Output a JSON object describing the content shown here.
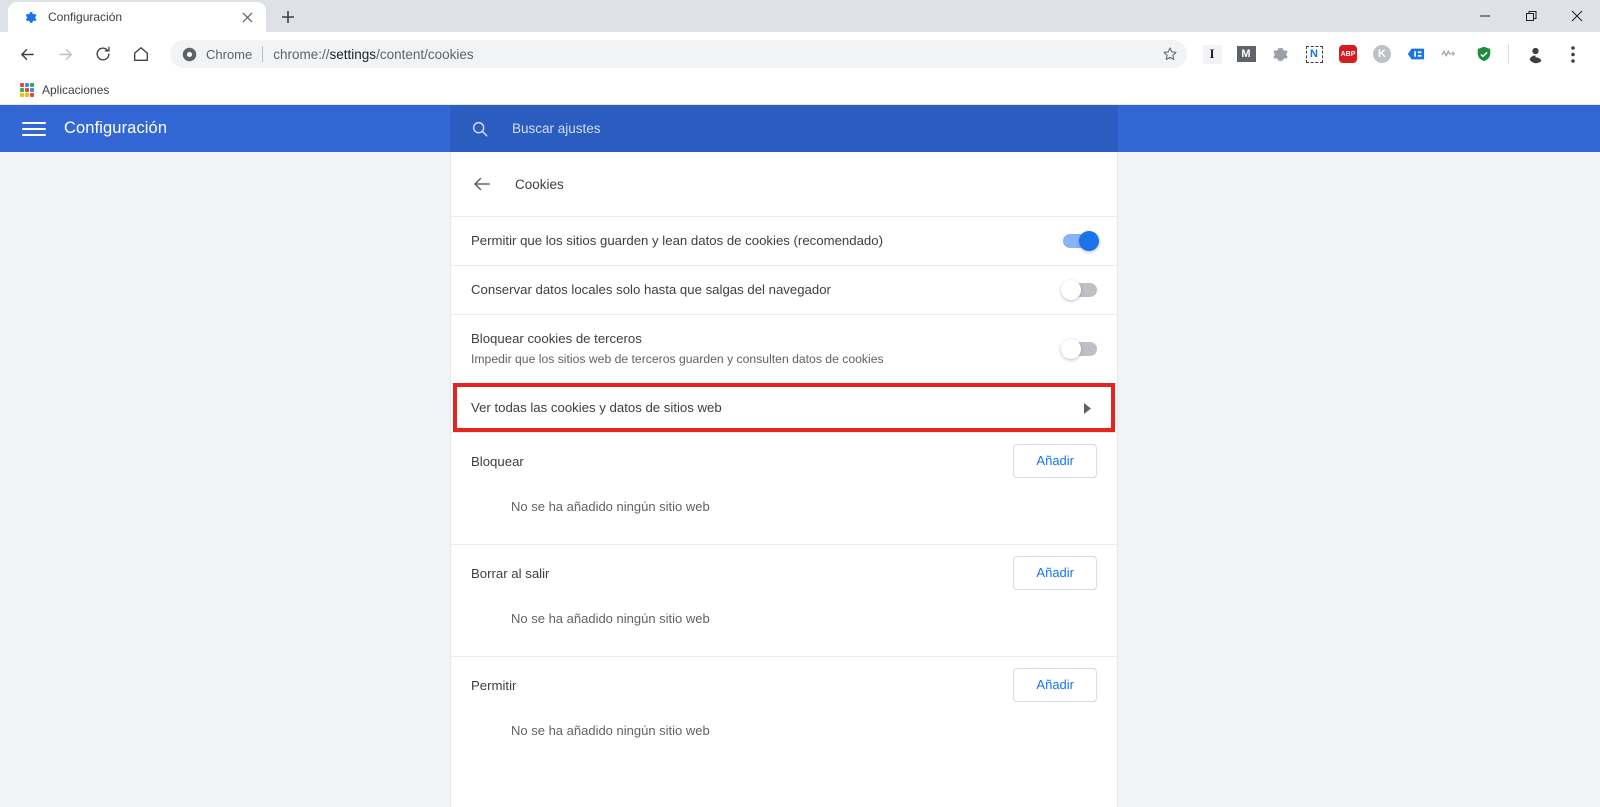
{
  "window": {
    "controls": {
      "minimize": "minimize-icon",
      "maximize": "maximize-icon",
      "close": "close-icon"
    }
  },
  "browser": {
    "tab": {
      "title": "Configuración",
      "favicon": "settings-gear-icon",
      "close_label": "×"
    },
    "new_tab_label": "+",
    "nav": {
      "back": "back-arrow-icon",
      "forward": "forward-arrow-icon",
      "reload": "reload-icon",
      "home": "home-icon"
    },
    "omnibox": {
      "chip": "Chrome",
      "url_prefix": "chrome://",
      "url_bold": "settings",
      "url_suffix": "/content/cookies",
      "full_url": "chrome://settings/content/cookies",
      "star": "bookmark-star-icon"
    },
    "extensions": [
      {
        "name": "instapaper-extension",
        "glyph": "I",
        "bg": "#f1f3f4",
        "fg": "#202124"
      },
      {
        "name": "mailtrack-extension",
        "glyph": "M",
        "bg": "#5f6368",
        "fg": "#ffffff"
      },
      {
        "name": "gear-extension",
        "glyph": "⚙",
        "bg": "transparent",
        "fg": "#9aa0a6"
      },
      {
        "name": "nimbus-extension",
        "glyph": "N",
        "bg": "transparent",
        "fg": "#1a73e8"
      },
      {
        "name": "adblock-plus-extension",
        "glyph": "ABP",
        "bg": "#d81b1b",
        "fg": "#ffffff"
      },
      {
        "name": "kaspersky-extension",
        "glyph": "K",
        "bg": "#bdc1c6",
        "fg": "#ffffff"
      },
      {
        "name": "blue-tag-extension",
        "glyph": "▤",
        "bg": "transparent",
        "fg": "#1a73e8"
      },
      {
        "name": "wave-extension",
        "glyph": "ᴡ",
        "bg": "transparent",
        "fg": "#9aa0a6"
      },
      {
        "name": "green-shield-extension",
        "glyph": "♻",
        "bg": "transparent",
        "fg": "#1e8e3e"
      }
    ],
    "profile": "profile-avatar-icon",
    "menu": "three-dot-menu-icon",
    "bookmarks": [
      {
        "name": "apps-shortcut",
        "label": "Aplicaciones",
        "icon": "apps-grid-icon"
      }
    ]
  },
  "settings": {
    "header": {
      "menu_button": "hamburger-menu-icon",
      "title": "Configuración",
      "search_icon": "search-icon",
      "search_placeholder": "Buscar ajustes",
      "search_value": ""
    },
    "page": {
      "back": "back-arrow-icon",
      "title": "Cookies"
    },
    "toggle_rows": [
      {
        "name": "allow-sites-save-read-cookies",
        "title": "Permitir que los sitios guarden y lean datos de cookies (recomendado)",
        "sub": "",
        "state": "on"
      },
      {
        "name": "keep-local-data-until-quit",
        "title": "Conservar datos locales solo hasta que salgas del navegador",
        "sub": "",
        "state": "off"
      },
      {
        "name": "block-third-party-cookies",
        "title": "Bloquear cookies de terceros",
        "sub": "Impedir que los sitios web de terceros guarden y consulten datos de cookies",
        "state": "off"
      }
    ],
    "highlighted_row": {
      "name": "see-all-cookies-and-site-data",
      "title": "Ver todas las cookies y datos de sitios web",
      "chevron": "chevron-right-icon",
      "highlight_color": "#e8221c"
    },
    "permission_sections": [
      {
        "name": "block-section",
        "title": "Bloquear",
        "add_label": "Añadir",
        "empty": "No se ha añadido ningún sitio web"
      },
      {
        "name": "clear-on-exit-section",
        "title": "Borrar al salir",
        "add_label": "Añadir",
        "empty": "No se ha añadido ningún sitio web"
      },
      {
        "name": "allow-section",
        "title": "Permitir",
        "add_label": "Añadir",
        "empty": "No se ha añadido ningún sitio web"
      }
    ],
    "colors": {
      "header_blue": "#3367d6",
      "search_blue": "#2b5cc0",
      "accent_blue": "#1a73e8",
      "toggle_on_track": "#8ab4f8",
      "page_bg": "#f1f3f4"
    }
  }
}
